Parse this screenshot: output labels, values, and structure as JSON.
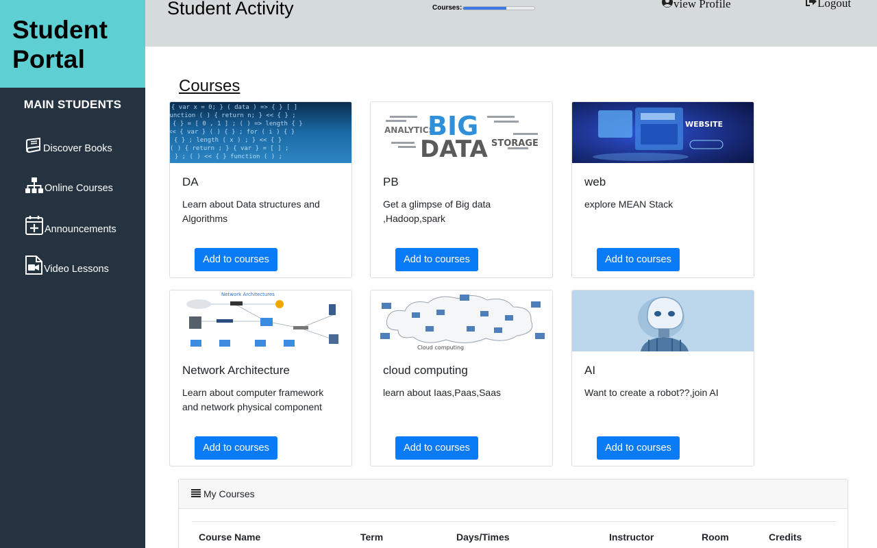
{
  "sidebar": {
    "brand_line1": "Student",
    "brand_line2": "Portal",
    "heading": "MAIN STUDENTS",
    "items": [
      {
        "label": "Discover Books",
        "icon": "book-icon"
      },
      {
        "label": "Online Courses",
        "icon": "sitemap-icon"
      },
      {
        "label": "Announcements",
        "icon": "calendar-plus-icon"
      },
      {
        "label": "Video Lessons",
        "icon": "video-file-icon"
      }
    ]
  },
  "header": {
    "title": "Student Activity",
    "progress_label": "Courses:",
    "progress_percent": 60,
    "view_profile": "view Profile",
    "logout": "Logout"
  },
  "courses": {
    "title": "Courses",
    "button_label": "Add to courses",
    "cards": [
      {
        "title": "DA",
        "text": "Learn about Data structures and Algorithms"
      },
      {
        "title": "PB",
        "text": "Get a glimpse of Big data ,Hadoop,spark",
        "image_text": [
          "BIG",
          "DATA",
          "ANALYTICS",
          "STORAGE"
        ]
      },
      {
        "title": "web",
        "text": "explore MEAN Stack",
        "image_text": [
          "WEBSITE"
        ]
      },
      {
        "title": "Network Architecture",
        "text": "Learn about computer framework and network physical component",
        "image_text": [
          "Network Architectures"
        ]
      },
      {
        "title": "cloud computing",
        "text": "learn about Iaas,Paas,Saas",
        "image_text": [
          "Cloud computing"
        ]
      },
      {
        "title": "AI",
        "text": "Want to create a robot??,join AI"
      }
    ]
  },
  "my_courses": {
    "title": "My Courses",
    "columns": [
      "Course Name",
      "Term",
      "Days/Times",
      "Instructor",
      "Room",
      "Credits"
    ]
  },
  "colors": {
    "sidebar_bg": "#253341",
    "brand_bg": "#5ecfd3",
    "topbar_bg": "#d5dbdb",
    "button_bg": "#0a7bf6"
  }
}
